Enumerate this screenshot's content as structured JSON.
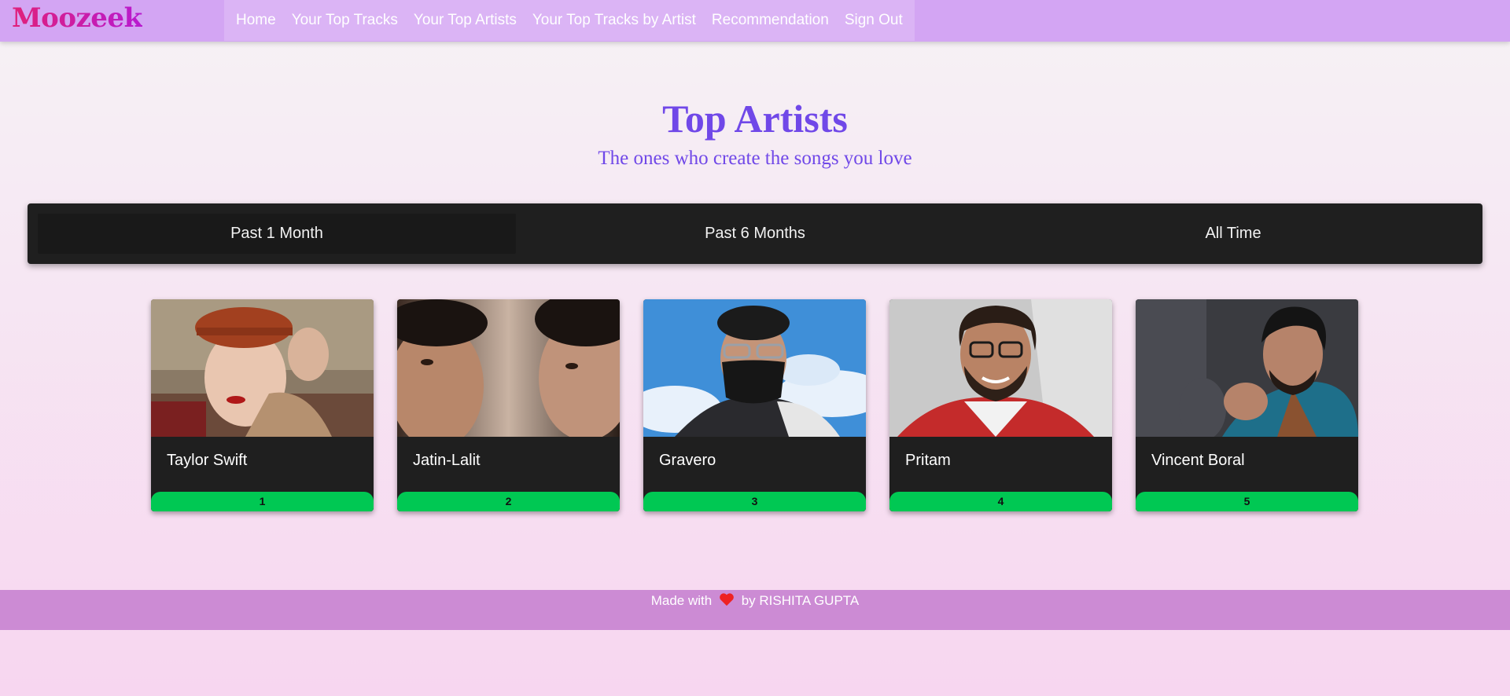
{
  "brand": {
    "logo": "Moozeek"
  },
  "nav": {
    "items": [
      {
        "label": "Home"
      },
      {
        "label": "Your Top Tracks"
      },
      {
        "label": "Your Top Artists"
      },
      {
        "label": "Your Top Tracks by Artist"
      },
      {
        "label": "Recommendation"
      },
      {
        "label": "Sign Out"
      }
    ]
  },
  "hero": {
    "title": "Top Artists",
    "subtitle": "The ones who create the songs you love"
  },
  "tabs": [
    {
      "label": "Past 1 Month",
      "active": true
    },
    {
      "label": "Past 6 Months",
      "active": false
    },
    {
      "label": "All Time",
      "active": false
    }
  ],
  "artists": [
    {
      "name": "Taylor Swift",
      "rank": "1"
    },
    {
      "name": "Jatin-Lalit",
      "rank": "2"
    },
    {
      "name": "Gravero",
      "rank": "3"
    },
    {
      "name": "Pritam",
      "rank": "4"
    },
    {
      "name": "Vincent Boral",
      "rank": "5"
    }
  ],
  "footer": {
    "prefix": "Made with",
    "suffix": "by RISHITA GUPTA",
    "heart_icon": "heart-icon"
  },
  "colors": {
    "navbar": "#d3a5f3",
    "accent": "#7048e8",
    "rank_badge": "#00c853",
    "footer": "#cc8bd4",
    "card": "#1f1f1f"
  }
}
